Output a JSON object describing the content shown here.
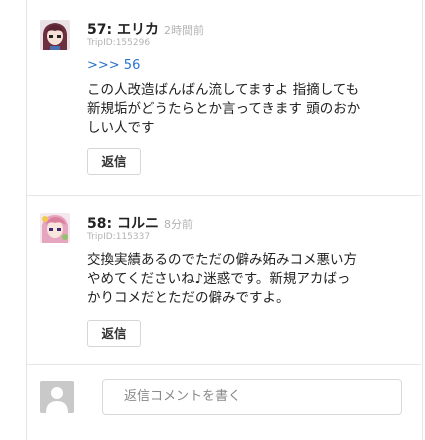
{
  "comments": [
    {
      "number_name": "57: エリカ",
      "time": "2時間前",
      "tripid": "TripID:155296",
      "anchor": ">>> 56",
      "body": "この人改造ばんばん流してますよ 指摘しても\n新規垢がどうたらとか言ってきます 頭のおか\nしい人です",
      "reply_label": "返信",
      "avatar_icon": "user-avatar-anime-girl"
    },
    {
      "number_name": "58: コルニ",
      "time": "8分前",
      "tripid": "TripID:115337",
      "body": "交換実績あるのでただの僻み妬みコメ悪い方\nやめてくださいね♪迷惑です。新規アカばっ\nかりコメだとただの僻みですよ。",
      "reply_label": "返信",
      "avatar_icon": "user-avatar-anime-pink"
    }
  ],
  "reply_box": {
    "placeholder": "返信コメントを書く",
    "avatar_icon": "default-user-icon"
  },
  "colors": {
    "anchor": "#2a72d0",
    "timestamp": "#b3b3b3",
    "divider": "#e6e6e6"
  }
}
